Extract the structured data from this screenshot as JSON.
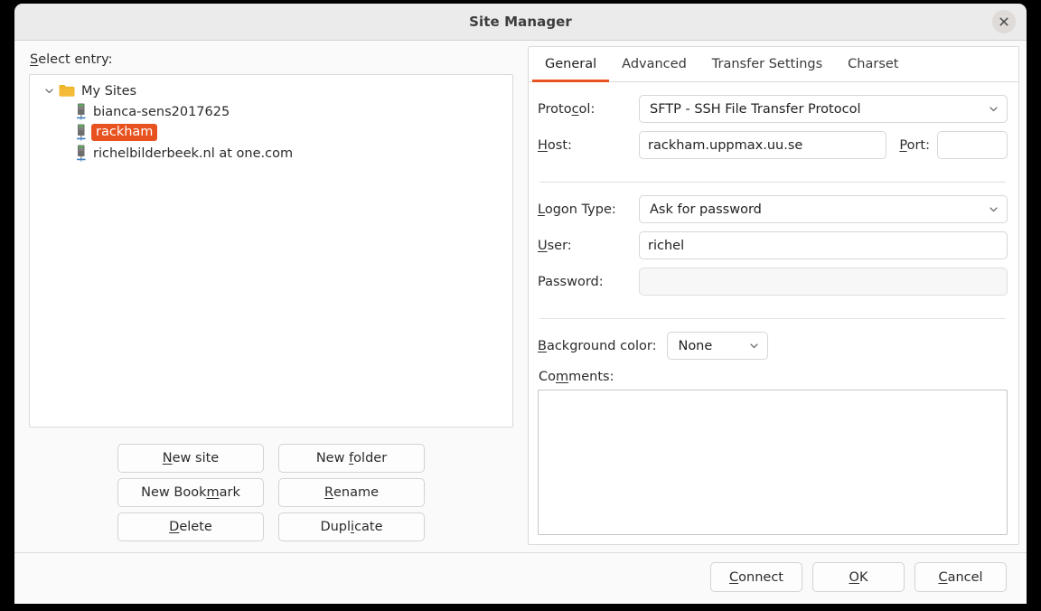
{
  "window": {
    "title": "Site Manager",
    "close_icon": "close-icon"
  },
  "left": {
    "select_entry_label": "Select entry:",
    "tree": {
      "root": {
        "label": "My Sites",
        "icon": "folder-icon",
        "expanded": true,
        "chevron_icon": "chevron-down-icon"
      },
      "items": [
        {
          "label": "bianca-sens2017625",
          "icon": "server-icon",
          "selected": false
        },
        {
          "label": "rackham",
          "icon": "server-icon",
          "selected": true
        },
        {
          "label": "richelbilderbeek.nl at one.com",
          "icon": "server-icon",
          "selected": false
        }
      ]
    },
    "buttons": [
      {
        "label": "New site",
        "mnemonic": "N"
      },
      {
        "label": "New folder",
        "mnemonic": "f"
      },
      {
        "label": "New Bookmark",
        "mnemonic": "m"
      },
      {
        "label": "Rename",
        "mnemonic": "R"
      },
      {
        "label": "Delete",
        "mnemonic": "D"
      },
      {
        "label": "Duplicate",
        "mnemonic": "i"
      }
    ]
  },
  "right": {
    "tabs": [
      {
        "label": "General",
        "active": true
      },
      {
        "label": "Advanced",
        "active": false
      },
      {
        "label": "Transfer Settings",
        "active": false
      },
      {
        "label": "Charset",
        "active": false
      }
    ],
    "general": {
      "protocol_label": "Protocol:",
      "protocol_value": "SFTP - SSH File Transfer Protocol",
      "host_label": "Host:",
      "host_value": "rackham.uppmax.uu.se",
      "port_label": "Port:",
      "port_value": "",
      "logon_type_label": "Logon Type:",
      "logon_type_value": "Ask for password",
      "user_label": "User:",
      "user_value": "richel",
      "password_label": "Password:",
      "password_value": "",
      "background_color_label": "Background color:",
      "background_color_value": "None",
      "comments_label": "Comments:",
      "comments_value": ""
    }
  },
  "footer": {
    "buttons": [
      {
        "label": "Connect",
        "mnemonic": "C"
      },
      {
        "label": "OK",
        "mnemonic": "O"
      },
      {
        "label": "Cancel",
        "mnemonic": "C"
      }
    ]
  },
  "colors": {
    "accent": "#e8521f",
    "titlebar": "#ebebeb",
    "folder": "#f0b429",
    "window_bg": "#fafafa"
  }
}
